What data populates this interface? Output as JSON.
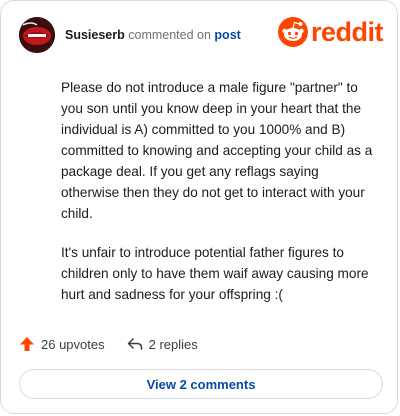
{
  "header": {
    "username": "Susieserb",
    "verb": "commented on",
    "post_link": "post",
    "logo_text": "reddit"
  },
  "comment": {
    "paragraphs": [
      "Please do not introduce a male figure \"partner\" to you son until you know deep in your heart that the individual is A) committed to you 1000% and B) committed to knowing and accepting your child as a package deal. If you get any reflags saying otherwise then they do not get to interact with your child.",
      "It's unfair to introduce potential father figures to children only to have them waif away causing more hurt and sadness for your offspring :("
    ]
  },
  "actions": {
    "upvotes": "26 upvotes",
    "replies": "2 replies"
  },
  "footer": {
    "view_button": "View 2 comments"
  },
  "colors": {
    "accent": "#ff4500",
    "link": "#0b4aa8"
  },
  "icons": {
    "avatar": "user-avatar",
    "logo": "reddit-logo-icon",
    "upvote": "upvote-arrow-icon",
    "reply": "reply-arrow-icon"
  }
}
